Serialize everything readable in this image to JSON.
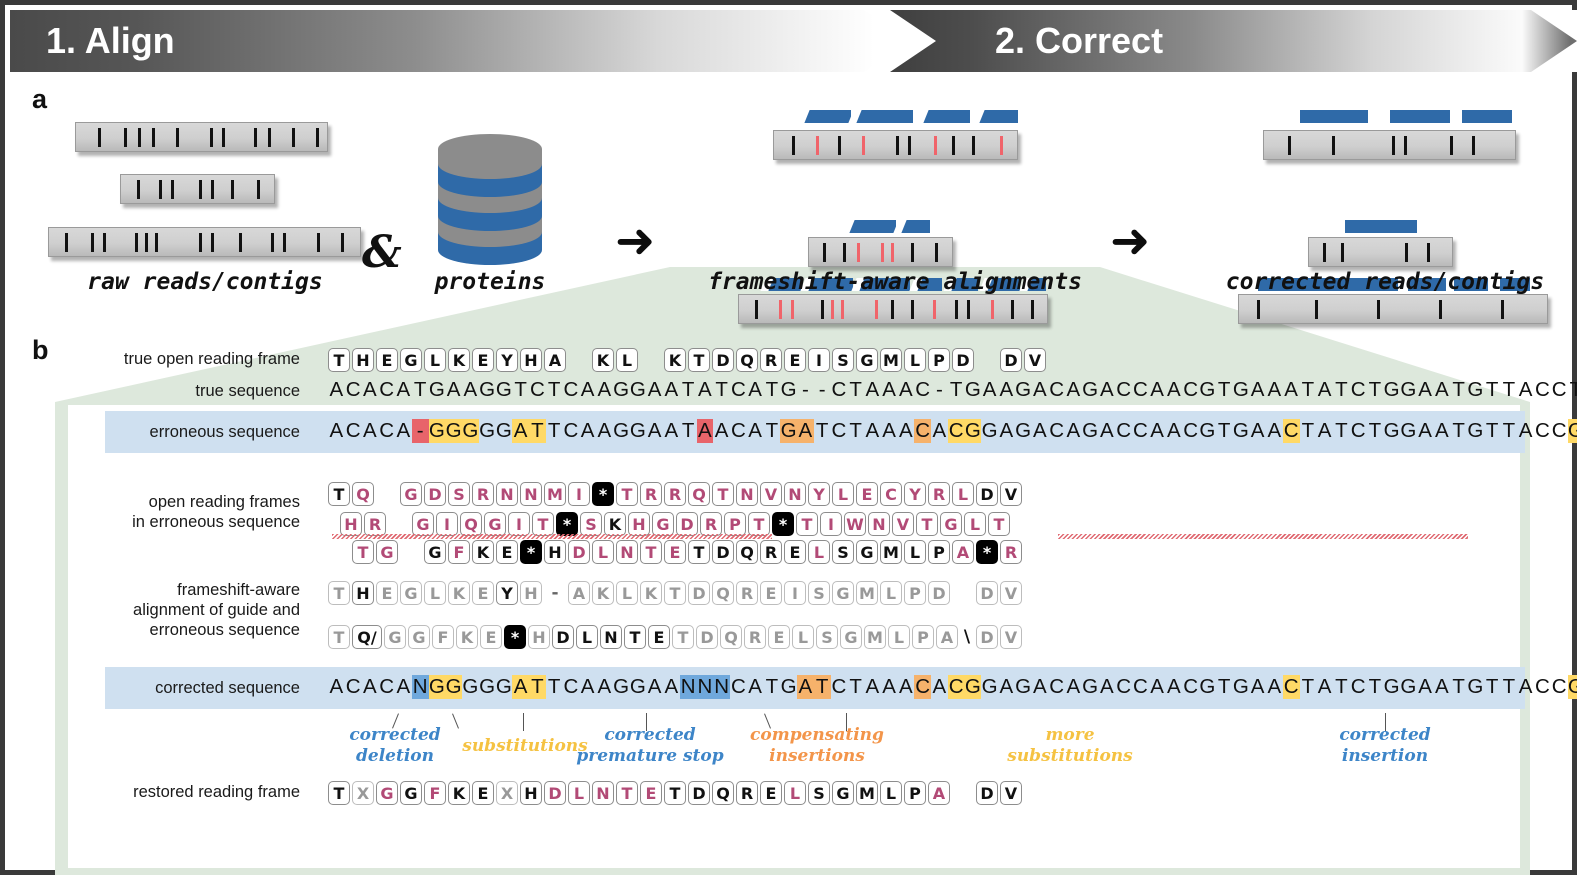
{
  "figure": {
    "banner": {
      "step1": "1. Align",
      "step2": "2. Correct"
    },
    "panel_a": {
      "letter": "a",
      "captions": {
        "raw": "raw reads/contigs",
        "proteins": "proteins",
        "alignments": "frameshift-aware alignments",
        "corrected": "corrected reads/contigs"
      },
      "conjunction": "&",
      "arrow": "➜"
    },
    "panel_b": {
      "letter": "b",
      "labels": {
        "true_orf": "true open reading frame",
        "true_seq": "true sequence",
        "erroneous_seq": "erroneous sequence",
        "orfs_erroneous": "open reading frames\nin erroneous sequence",
        "orfs_erroneous_l1": "open reading frames",
        "orfs_erroneous_l2": "in erroneous sequence",
        "fs_alignment_l1": "frameshift-aware",
        "fs_alignment_l2": "alignment of guide and",
        "fs_alignment_l3": "erroneous sequence",
        "corrected_seq": "corrected sequence",
        "restored_frame": "restored reading frame"
      },
      "true_orf": [
        {
          "t": "T"
        },
        {
          "t": "H"
        },
        {
          "t": "E"
        },
        {
          "t": "G"
        },
        {
          "t": "L"
        },
        {
          "t": "K"
        },
        {
          "t": "E"
        },
        {
          "t": "Y"
        },
        {
          "t": "H"
        },
        {
          "t": "A"
        },
        {
          "t": "",
          "gap": true
        },
        {
          "t": "K"
        },
        {
          "t": "L"
        },
        {
          "t": "",
          "gap": true
        },
        {
          "t": "K"
        },
        {
          "t": "T"
        },
        {
          "t": "D"
        },
        {
          "t": "Q"
        },
        {
          "t": "R"
        },
        {
          "t": "E"
        },
        {
          "t": "I"
        },
        {
          "t": "S"
        },
        {
          "t": "G"
        },
        {
          "t": "M"
        },
        {
          "t": "L"
        },
        {
          "t": "P"
        },
        {
          "t": "D"
        },
        {
          "t": "",
          "gap": true
        },
        {
          "t": "D"
        },
        {
          "t": "V"
        }
      ],
      "true_sequence": "ACACATGAAGGTCTCAAGGAATATCATG--CTAAAC-TGAAGACAGACCAACGTGAAATATCTGGAATGTTACCTGA-TGATGTA",
      "erroneous_sequence": "ACACA-GGGGGATTCAAGGAATAACATGATCTAAACACGGAGACAGACCAACGTGAACTATCTGGAATGTTACCGGCTTGACGTA",
      "erroneous_highlights": [
        {
          "i": 5,
          "c": "r"
        },
        {
          "i": 6,
          "c": "y"
        },
        {
          "i": 7,
          "c": "y"
        },
        {
          "i": 8,
          "c": "y"
        },
        {
          "i": 11,
          "c": "y"
        },
        {
          "i": 12,
          "c": "y"
        },
        {
          "i": 22,
          "c": "r"
        },
        {
          "i": 27,
          "c": "o"
        },
        {
          "i": 28,
          "c": "o"
        },
        {
          "i": 35,
          "c": "o"
        },
        {
          "i": 37,
          "c": "y"
        },
        {
          "i": 38,
          "c": "y"
        },
        {
          "i": 57,
          "c": "y"
        },
        {
          "i": 74,
          "c": "y"
        },
        {
          "i": 76,
          "c": "y"
        },
        {
          "i": 77,
          "c": "r"
        },
        {
          "i": 81,
          "c": "y"
        }
      ],
      "corrected_sequence": "ACACANGGGGGATTCAAGGAANNNCATGATCTAAACACGGAGACAGACCAACGTGAACTATCTGGAATGTTACCGGC-TGACGTA",
      "corrected_highlights": [
        {
          "i": 5,
          "c": "b"
        },
        {
          "i": 6,
          "c": "y"
        },
        {
          "i": 7,
          "c": "y"
        },
        {
          "i": 11,
          "c": "y"
        },
        {
          "i": 12,
          "c": "y"
        },
        {
          "i": 21,
          "c": "b"
        },
        {
          "i": 22,
          "c": "b"
        },
        {
          "i": 23,
          "c": "b"
        },
        {
          "i": 28,
          "c": "o"
        },
        {
          "i": 29,
          "c": "o"
        },
        {
          "i": 35,
          "c": "o"
        },
        {
          "i": 37,
          "c": "y"
        },
        {
          "i": 38,
          "c": "y"
        },
        {
          "i": 57,
          "c": "y"
        },
        {
          "i": 74,
          "c": "y"
        },
        {
          "i": 76,
          "c": "y"
        },
        {
          "i": 77,
          "c": "b"
        },
        {
          "i": 81,
          "c": "y"
        }
      ],
      "orf_frame1": [
        {
          "t": "T",
          "s": "blk-letter"
        },
        {
          "t": "Q",
          "s": "pink"
        },
        {
          "t": "",
          "sp": 1
        },
        {
          "t": "G",
          "s": "pink"
        },
        {
          "t": "D",
          "s": "pink"
        },
        {
          "t": "S",
          "s": "pink"
        },
        {
          "t": "R",
          "s": "pink"
        },
        {
          "t": "N",
          "s": "pink"
        },
        {
          "t": "N",
          "s": "pink"
        },
        {
          "t": "M",
          "s": "pink"
        },
        {
          "t": "I",
          "s": "pink"
        },
        {
          "t": "*",
          "s": "stop"
        },
        {
          "t": "T",
          "s": "pink"
        },
        {
          "t": "R",
          "s": "pink"
        },
        {
          "t": "R",
          "s": "pink"
        },
        {
          "t": "Q",
          "s": "pink"
        },
        {
          "t": "T",
          "s": "pink"
        },
        {
          "t": "N",
          "s": "pink"
        },
        {
          "t": "V",
          "s": "pink"
        },
        {
          "t": "N",
          "s": "pink"
        },
        {
          "t": "Y",
          "s": "pink"
        },
        {
          "t": "L",
          "s": "pink"
        },
        {
          "t": "E",
          "s": "pink"
        },
        {
          "t": "C",
          "s": "pink"
        },
        {
          "t": "Y",
          "s": "pink"
        },
        {
          "t": "R",
          "s": "pink"
        },
        {
          "t": "L",
          "s": "pink"
        },
        {
          "t": "D"
        },
        {
          "t": "V"
        }
      ],
      "orf_frame2": [
        {
          "t": "H",
          "s": "pink"
        },
        {
          "t": "R",
          "s": "pink"
        },
        {
          "t": "",
          "sp": 1
        },
        {
          "t": "G",
          "s": "pink"
        },
        {
          "t": "I",
          "s": "pink"
        },
        {
          "t": "Q",
          "s": "pink"
        },
        {
          "t": "G",
          "s": "pink"
        },
        {
          "t": "I",
          "s": "pink"
        },
        {
          "t": "T",
          "s": "pink"
        },
        {
          "t": "*",
          "s": "stop"
        },
        {
          "t": "S",
          "s": "pink"
        },
        {
          "t": "K"
        },
        {
          "t": "H",
          "s": "pink"
        },
        {
          "t": "G",
          "s": "pink"
        },
        {
          "t": "D",
          "s": "pink"
        },
        {
          "t": "R",
          "s": "pink"
        },
        {
          "t": "P",
          "s": "pink"
        },
        {
          "t": "T",
          "s": "pink"
        },
        {
          "t": "*",
          "s": "stop"
        },
        {
          "t": "T",
          "s": "pink"
        },
        {
          "t": "I",
          "s": "pink"
        },
        {
          "t": "W",
          "s": "pink"
        },
        {
          "t": "N",
          "s": "pink"
        },
        {
          "t": "V",
          "s": "pink"
        },
        {
          "t": "T",
          "s": "pink"
        },
        {
          "t": "G",
          "s": "pink"
        },
        {
          "t": "L",
          "s": "pink"
        },
        {
          "t": "T",
          "s": "pink"
        }
      ],
      "orf_frame3": [
        {
          "t": "T",
          "s": "pink"
        },
        {
          "t": "G",
          "s": "pink"
        },
        {
          "t": "",
          "sp": 1
        },
        {
          "t": "G"
        },
        {
          "t": "F",
          "s": "pink"
        },
        {
          "t": "K"
        },
        {
          "t": "E"
        },
        {
          "t": "*",
          "s": "stop"
        },
        {
          "t": "H"
        },
        {
          "t": "D",
          "s": "pink"
        },
        {
          "t": "L",
          "s": "pink"
        },
        {
          "t": "N",
          "s": "pink"
        },
        {
          "t": "T",
          "s": "pink"
        },
        {
          "t": "E",
          "s": "pink"
        },
        {
          "t": "T"
        },
        {
          "t": "D"
        },
        {
          "t": "Q"
        },
        {
          "t": "R"
        },
        {
          "t": "E"
        },
        {
          "t": "L",
          "s": "pink"
        },
        {
          "t": "S"
        },
        {
          "t": "G"
        },
        {
          "t": "M"
        },
        {
          "t": "L"
        },
        {
          "t": "P"
        },
        {
          "t": "A",
          "s": "pink"
        },
        {
          "t": "*",
          "s": "stop"
        },
        {
          "t": "R",
          "s": "pink"
        }
      ],
      "align_guide": [
        {
          "t": "T",
          "s": "grey"
        },
        {
          "t": "H",
          "s": "dark"
        },
        {
          "t": "E",
          "s": "grey"
        },
        {
          "t": "G",
          "s": "grey"
        },
        {
          "t": "L",
          "s": "grey"
        },
        {
          "t": "K",
          "s": "grey"
        },
        {
          "t": "E",
          "s": "grey"
        },
        {
          "t": "Y",
          "s": "dark"
        },
        {
          "t": "H",
          "s": "grey"
        },
        {
          "t": "-",
          "s": "dash"
        },
        {
          "t": "A",
          "s": "grey"
        },
        {
          "t": "K",
          "s": "grey"
        },
        {
          "t": "L",
          "s": "grey"
        },
        {
          "t": "K",
          "s": "grey"
        },
        {
          "t": "T",
          "s": "grey"
        },
        {
          "t": "D",
          "s": "grey"
        },
        {
          "t": "Q",
          "s": "grey"
        },
        {
          "t": "R",
          "s": "grey"
        },
        {
          "t": "E",
          "s": "grey"
        },
        {
          "t": "I",
          "s": "grey"
        },
        {
          "t": "S",
          "s": "grey"
        },
        {
          "t": "G",
          "s": "grey"
        },
        {
          "t": "M",
          "s": "grey"
        },
        {
          "t": "L",
          "s": "grey"
        },
        {
          "t": "P",
          "s": "grey"
        },
        {
          "t": "D",
          "s": "grey"
        },
        {
          "t": "",
          "sp": 1
        },
        {
          "t": "D",
          "s": "grey"
        },
        {
          "t": "V",
          "s": "grey"
        }
      ],
      "align_query": [
        {
          "t": "T",
          "s": "grey"
        },
        {
          "t": "Q/",
          "s": "dark"
        },
        {
          "t": "G",
          "s": "grey"
        },
        {
          "t": "G",
          "s": "grey"
        },
        {
          "t": "F",
          "s": "grey"
        },
        {
          "t": "K",
          "s": "grey"
        },
        {
          "t": "E",
          "s": "grey"
        },
        {
          "t": "*",
          "s": "stop"
        },
        {
          "t": "H",
          "s": "grey"
        },
        {
          "t": "D",
          "s": "dark"
        },
        {
          "t": "L",
          "s": "dark"
        },
        {
          "t": "N",
          "s": "dark"
        },
        {
          "t": "T",
          "s": "dark"
        },
        {
          "t": "E",
          "s": "dark"
        },
        {
          "t": "T",
          "s": "grey"
        },
        {
          "t": "D",
          "s": "grey"
        },
        {
          "t": "Q",
          "s": "grey"
        },
        {
          "t": "R",
          "s": "grey"
        },
        {
          "t": "E",
          "s": "grey"
        },
        {
          "t": "L",
          "s": "grey"
        },
        {
          "t": "S",
          "s": "grey"
        },
        {
          "t": "G",
          "s": "grey"
        },
        {
          "t": "M",
          "s": "grey"
        },
        {
          "t": "L",
          "s": "grey"
        },
        {
          "t": "P",
          "s": "grey"
        },
        {
          "t": "A",
          "s": "grey"
        },
        {
          "t": "\\",
          "s": "slash"
        },
        {
          "t": "D",
          "s": "grey"
        },
        {
          "t": "V",
          "s": "grey"
        }
      ],
      "restored_frame": [
        {
          "t": "T"
        },
        {
          "t": "X",
          "s": "grey"
        },
        {
          "t": "G",
          "s": "pink"
        },
        {
          "t": "G"
        },
        {
          "t": "F",
          "s": "pink"
        },
        {
          "t": "K"
        },
        {
          "t": "E"
        },
        {
          "t": "X",
          "s": "grey"
        },
        {
          "t": "H"
        },
        {
          "t": "D",
          "s": "pink"
        },
        {
          "t": "L",
          "s": "pink"
        },
        {
          "t": "N",
          "s": "pink"
        },
        {
          "t": "T",
          "s": "pink"
        },
        {
          "t": "E",
          "s": "pink"
        },
        {
          "t": "T"
        },
        {
          "t": "D"
        },
        {
          "t": "Q"
        },
        {
          "t": "R"
        },
        {
          "t": "E"
        },
        {
          "t": "L",
          "s": "pink"
        },
        {
          "t": "S"
        },
        {
          "t": "G"
        },
        {
          "t": "M"
        },
        {
          "t": "L"
        },
        {
          "t": "P"
        },
        {
          "t": "A",
          "s": "pink"
        },
        {
          "t": "",
          "sp": 1
        },
        {
          "t": "D"
        },
        {
          "t": "V"
        }
      ],
      "annotations": [
        {
          "id": "corrected-deletion",
          "l1": "corrected",
          "l2": "deletion",
          "color": "blue"
        },
        {
          "id": "substitutions",
          "l1": "substitutions",
          "l2": "",
          "color": "yel"
        },
        {
          "id": "corrected-premature-stop",
          "l1": "corrected",
          "l2": "premature stop",
          "color": "blue"
        },
        {
          "id": "compensating-insertions",
          "l1": "compensating",
          "l2": "insertions",
          "color": "ora"
        },
        {
          "id": "more-substitutions",
          "l1": "more",
          "l2": "substitutions",
          "color": "yel"
        },
        {
          "id": "corrected-insertion",
          "l1": "corrected",
          "l2": "insertion",
          "color": "blue"
        }
      ]
    },
    "colors": {
      "highlight_yellow": "#ffd966",
      "highlight_orange": "#f6b26b",
      "highlight_red": "#e8646a",
      "highlight_blue": "#6fa8dc",
      "band_blue": "#cfe0f0",
      "funnel_green": "#d9e7da",
      "hsp_blue": "#2f6aa8",
      "anno_blue": "#3d85c8",
      "anno_yellow": "#f5c242",
      "anno_orange": "#f3954a",
      "aa_pink": "#b24a76",
      "border": "#3a3a3a"
    }
  }
}
